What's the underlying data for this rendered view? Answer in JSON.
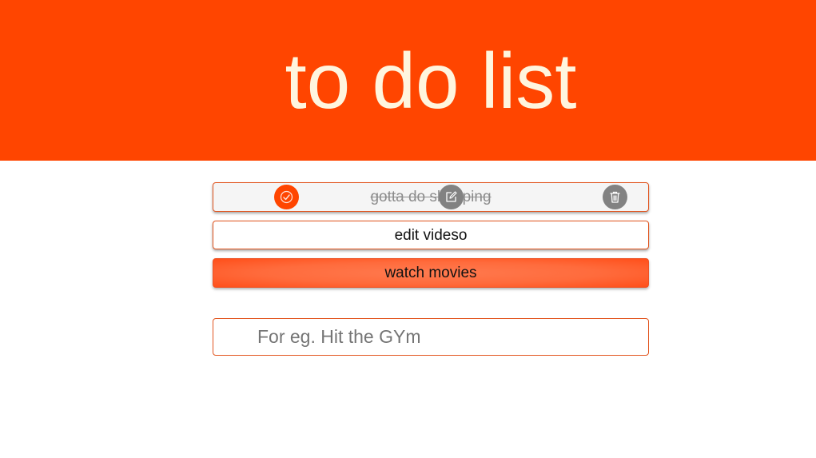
{
  "header": {
    "title": "to do list",
    "background": "#ff4500",
    "title_color": "#fff5de"
  },
  "todos": [
    {
      "text": "gotta do shopping",
      "completed": true,
      "actions": [
        "check-icon",
        "edit-icon",
        "trash-icon"
      ]
    },
    {
      "text": "edit videso",
      "completed": false
    },
    {
      "text": "watch movies",
      "completed": false,
      "highlighted": true
    }
  ],
  "new_todo": {
    "value": "",
    "placeholder": "For eg. Hit the GYm"
  },
  "colors": {
    "accent": "#ff4500",
    "border": "#e2551f",
    "action_gray": "#828282"
  }
}
